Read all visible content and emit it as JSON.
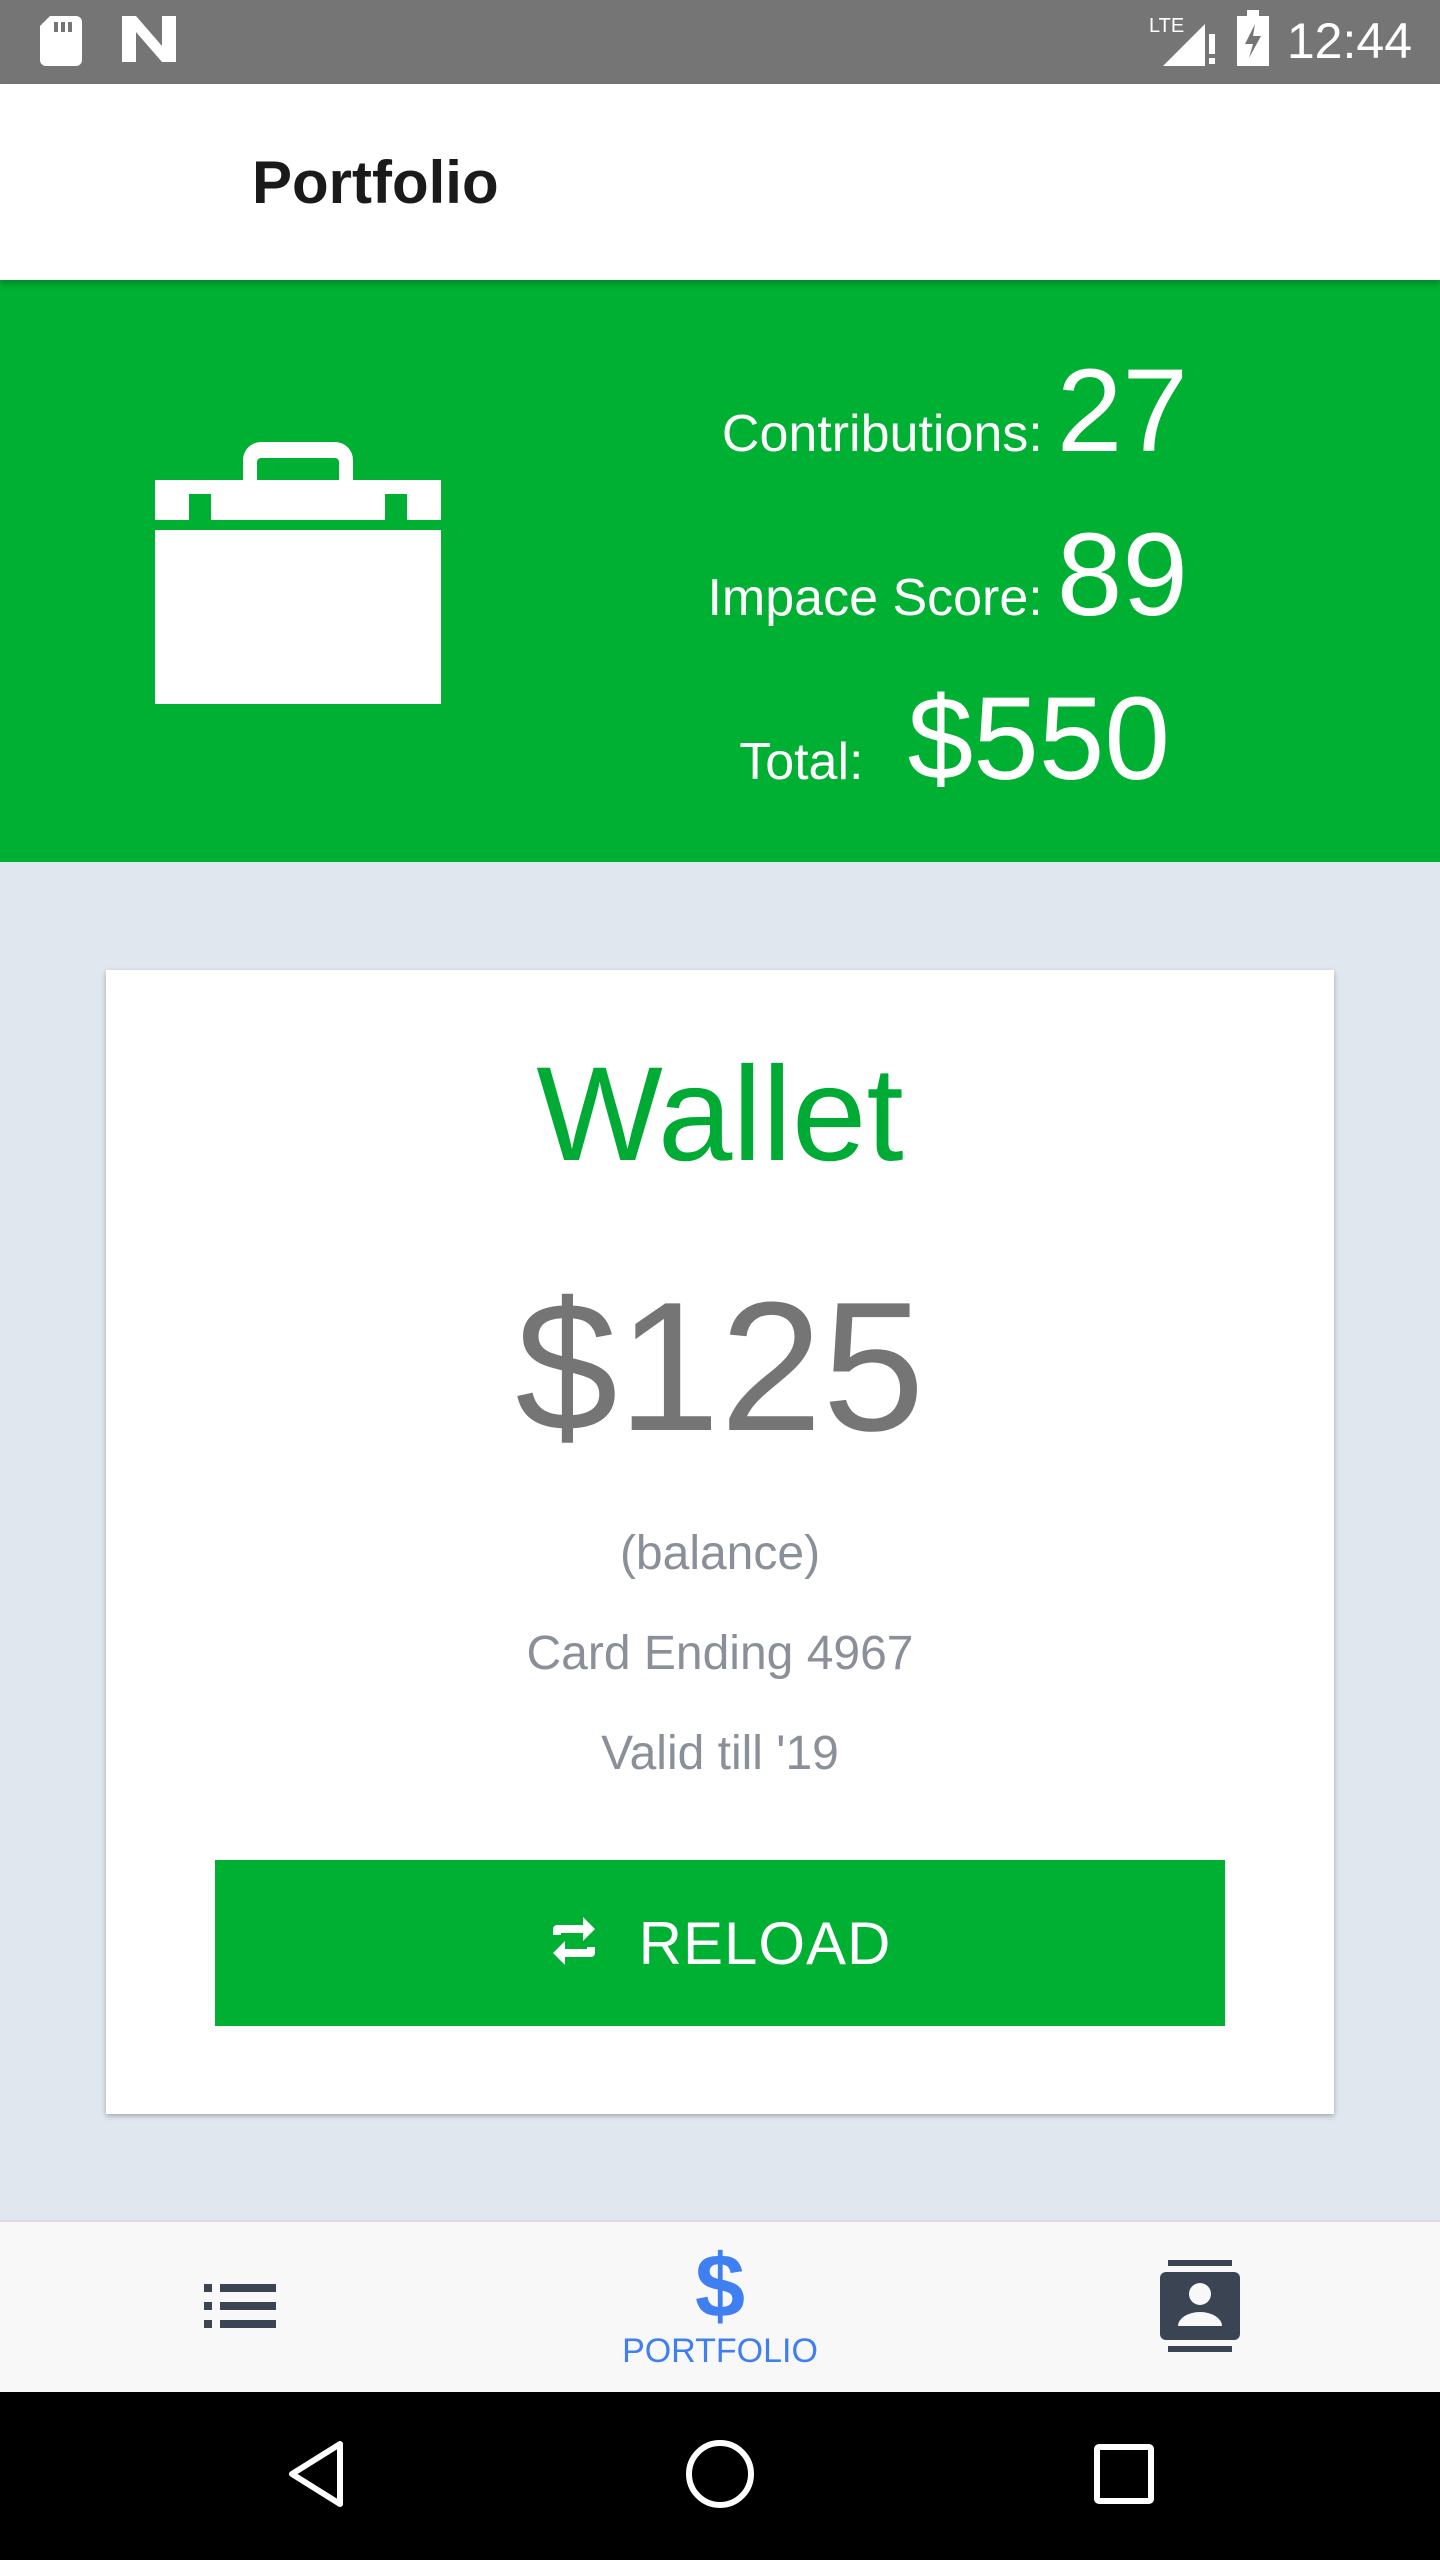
{
  "status_bar": {
    "time": "12:44",
    "network": "LTE",
    "icons": [
      "sd-card-icon",
      "n-logo-icon",
      "signal-icon",
      "battery-icon"
    ]
  },
  "app_bar": {
    "title": "Portfolio"
  },
  "stats": {
    "icon": "briefcase-icon",
    "contributions_label": "Contributions:",
    "contributions_value": "27",
    "impact_label": "Impace Score:",
    "impact_value": "89",
    "total_label": "Total:",
    "total_value": "$550"
  },
  "wallet": {
    "title": "Wallet",
    "amount": "$125",
    "balance_caption": "(balance)",
    "card_ending": "Card Ending 4967",
    "valid_till": "Valid till '19",
    "reload_label": "RELOAD",
    "reload_icon": "repeat-icon"
  },
  "bottom_nav": {
    "items": [
      {
        "icon": "list-icon",
        "label": ""
      },
      {
        "icon": "dollar-icon",
        "label": "PORTFOLIO",
        "active": true
      },
      {
        "icon": "contacts-icon",
        "label": ""
      }
    ]
  },
  "colors": {
    "brand_green": "#00b032",
    "wallet_title_green": "#00ab35",
    "active_nav_blue": "#3f7ff1",
    "status_bar_gray": "#757575",
    "page_background": "#e1e7ef"
  }
}
